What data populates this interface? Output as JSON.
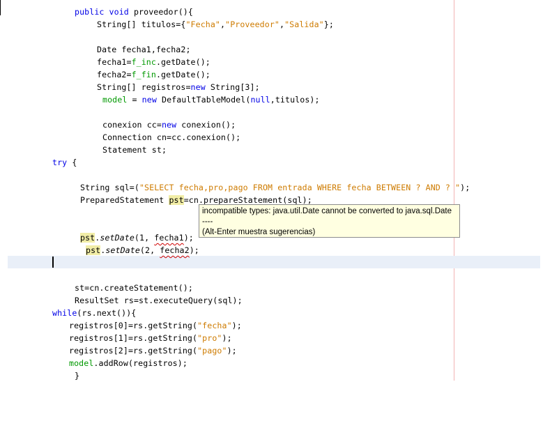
{
  "editor": {
    "line_method": [
      "public void",
      " proveedor(){"
    ],
    "line_titulos": [
      "String[] titulos={",
      "\"Fecha\"",
      ",",
      "\"Proveedor\"",
      ",",
      "\"Salida\"",
      "};"
    ],
    "line_dates": "Date fecha1,fecha2;",
    "line_fecha1": [
      "fecha1=",
      "f_inc",
      ".getDate();"
    ],
    "line_fecha2": [
      "fecha2=",
      "f_fin",
      ".getDate();"
    ],
    "line_registros": [
      "String[] registros=",
      "new",
      " String[3];"
    ],
    "line_model": [
      "model",
      " = ",
      "new",
      " DefaultTableModel(",
      "null",
      ",titulos);"
    ],
    "line_conexion": [
      "conexion cc=",
      "new",
      " conexion();"
    ],
    "line_connection": "Connection cn=cc.conexion();",
    "line_statement": "Statement st;",
    "line_try": [
      "try",
      " {"
    ],
    "line_sql": [
      "String sql=(",
      "\"SELECT fecha,pro,pago FROM entrada WHERE fecha BETWEEN ? AND ? \"",
      ");"
    ],
    "line_prepared": [
      "PreparedStatement ",
      "pst",
      "=cn.prepareStatement(sql);"
    ],
    "line_setdate1": [
      "pst",
      ".",
      "setDate",
      "(1, ",
      "fecha1",
      ");"
    ],
    "line_setdate2": [
      "pst",
      ".",
      "setDate",
      "(2, ",
      "fecha2",
      ");"
    ],
    "line_create": "st=cn.createStatement();",
    "line_resultset": "ResultSet rs=st.executeQuery(sql);",
    "line_while": [
      "while",
      "(rs.next()){"
    ],
    "line_reg0": [
      "registros[0]=rs.getString(",
      "\"fecha\"",
      ");"
    ],
    "line_reg1": [
      "registros[1]=rs.getString(",
      "\"pro\"",
      ");"
    ],
    "line_reg2": [
      "registros[2]=rs.getString(",
      "\"pago\"",
      ");"
    ],
    "line_addrow": [
      "model",
      ".addRow(registros);"
    ],
    "line_close": "}"
  },
  "tooltip": {
    "message": "incompatible types: java.util.Date cannot be converted to java.sql.Date",
    "separator": "----",
    "hint": "(Alt-Enter muestra sugerencias)"
  },
  "colors": {
    "keyword": "#0000e6",
    "string": "#ce7b00",
    "field": "#009900",
    "occurrence_highlight": "#f1eda6",
    "current_line": "#e9eff8",
    "tooltip_bg": "#ffffe1",
    "error_underline": "#d00000"
  }
}
